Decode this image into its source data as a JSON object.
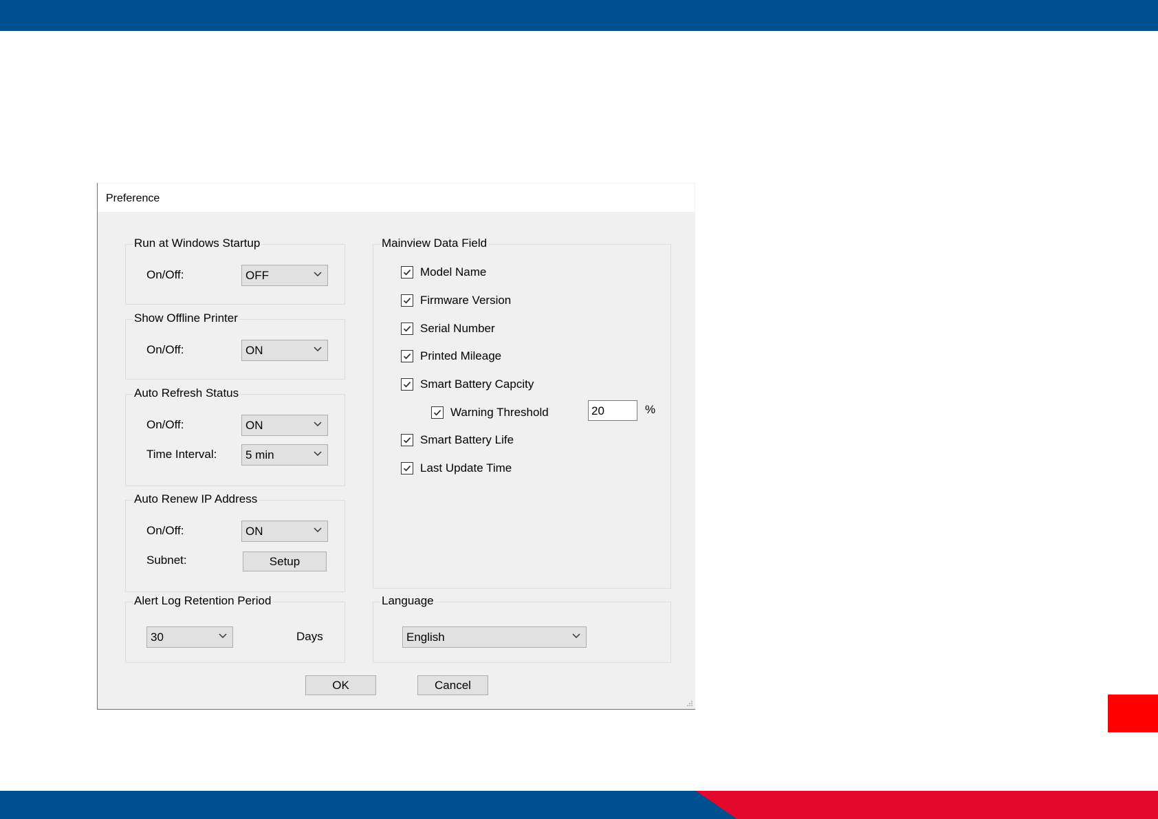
{
  "dialog": {
    "title": "Preference"
  },
  "startup": {
    "legend": "Run at Windows Startup",
    "onoff_label": "On/Off:",
    "onoff_value": "OFF"
  },
  "offline": {
    "legend": "Show Offline Printer",
    "onoff_label": "On/Off:",
    "onoff_value": "ON"
  },
  "refresh": {
    "legend": "Auto Refresh Status",
    "onoff_label": "On/Off:",
    "onoff_value": "ON",
    "interval_label": "Time Interval:",
    "interval_value": "5 min"
  },
  "renew": {
    "legend": "Auto Renew IP Address",
    "onoff_label": "On/Off:",
    "onoff_value": "ON",
    "subnet_label": "Subnet:",
    "setup_label": "Setup"
  },
  "alertlog": {
    "legend": "Alert Log Retention Period",
    "days_value": "30",
    "days_label": "Days"
  },
  "mainview": {
    "legend": "Mainview Data Field",
    "fields": [
      {
        "label": "Model Name",
        "checked": true
      },
      {
        "label": "Firmware Version",
        "checked": true
      },
      {
        "label": "Serial Number",
        "checked": true
      },
      {
        "label": "Printed Mileage",
        "checked": true
      },
      {
        "label": "Smart Battery Capcity",
        "checked": true
      },
      {
        "label": "Warning Threshold",
        "checked": true
      },
      {
        "label": "Smart Battery Life",
        "checked": true
      },
      {
        "label": "Last Update Time",
        "checked": true
      }
    ],
    "threshold_value": "20",
    "threshold_unit": "%"
  },
  "language": {
    "legend": "Language",
    "value": "English"
  },
  "buttons": {
    "ok": "OK",
    "cancel": "Cancel"
  },
  "colors": {
    "header_blue": "#00508f",
    "accent_red": "#e3092c"
  }
}
